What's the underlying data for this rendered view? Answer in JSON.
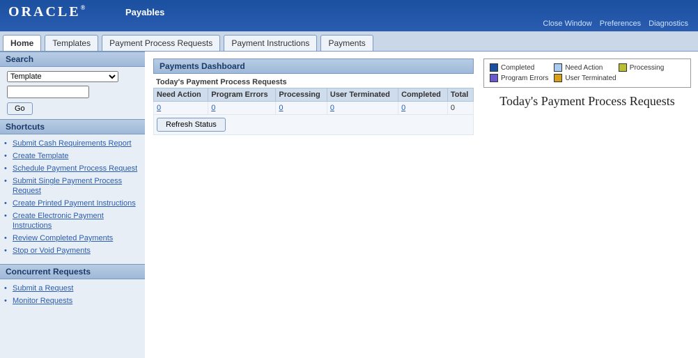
{
  "brand": "ORACLE",
  "brandMark": "®",
  "appTitle": "Payables",
  "topLinks": [
    "Close Window",
    "Preferences",
    "Diagnostics"
  ],
  "tabs": [
    "Home",
    "Templates",
    "Payment Process Requests",
    "Payment Instructions",
    "Payments"
  ],
  "activeTab": 0,
  "sidebar": {
    "searchHeader": "Search",
    "searchSelectValue": "Template",
    "searchInputValue": "",
    "goLabel": "Go",
    "shortcutsHeader": "Shortcuts",
    "shortcuts": [
      "Submit Cash Requirements Report",
      "Create Template",
      "Schedule Payment Process Request",
      "Submit Single Payment Process Request",
      "Create Printed Payment Instructions",
      "Create Electronic Payment Instructions",
      "Review Completed Payments",
      "Stop or Void Payments"
    ],
    "concHeader": "Concurrent Requests",
    "concLinks": [
      "Submit a Request",
      "Monitor Requests"
    ]
  },
  "dashboard": {
    "title": "Payments Dashboard",
    "subTitle": "Today's Payment Process Requests",
    "columns": [
      "Need Action",
      "Program Errors",
      "Processing",
      "User Terminated",
      "Completed",
      "Total"
    ],
    "row": [
      "0",
      "0",
      "0",
      "0",
      "0",
      "0"
    ],
    "refreshLabel": "Refresh Status"
  },
  "legend": [
    {
      "label": "Completed",
      "color": "#1b4f9f"
    },
    {
      "label": "Need Action",
      "color": "#a9cbef"
    },
    {
      "label": "Processing",
      "color": "#b9bf2e"
    },
    {
      "label": "Program Errors",
      "color": "#6a5acd"
    },
    {
      "label": "User Terminated",
      "color": "#d4a017"
    }
  ],
  "chart_data": {
    "type": "pie",
    "title": "Today's Payment Process Requests",
    "series": [
      {
        "name": "Completed",
        "value": 0
      },
      {
        "name": "Need Action",
        "value": 0
      },
      {
        "name": "Processing",
        "value": 0
      },
      {
        "name": "Program Errors",
        "value": 0
      },
      {
        "name": "User Terminated",
        "value": 0
      }
    ]
  }
}
